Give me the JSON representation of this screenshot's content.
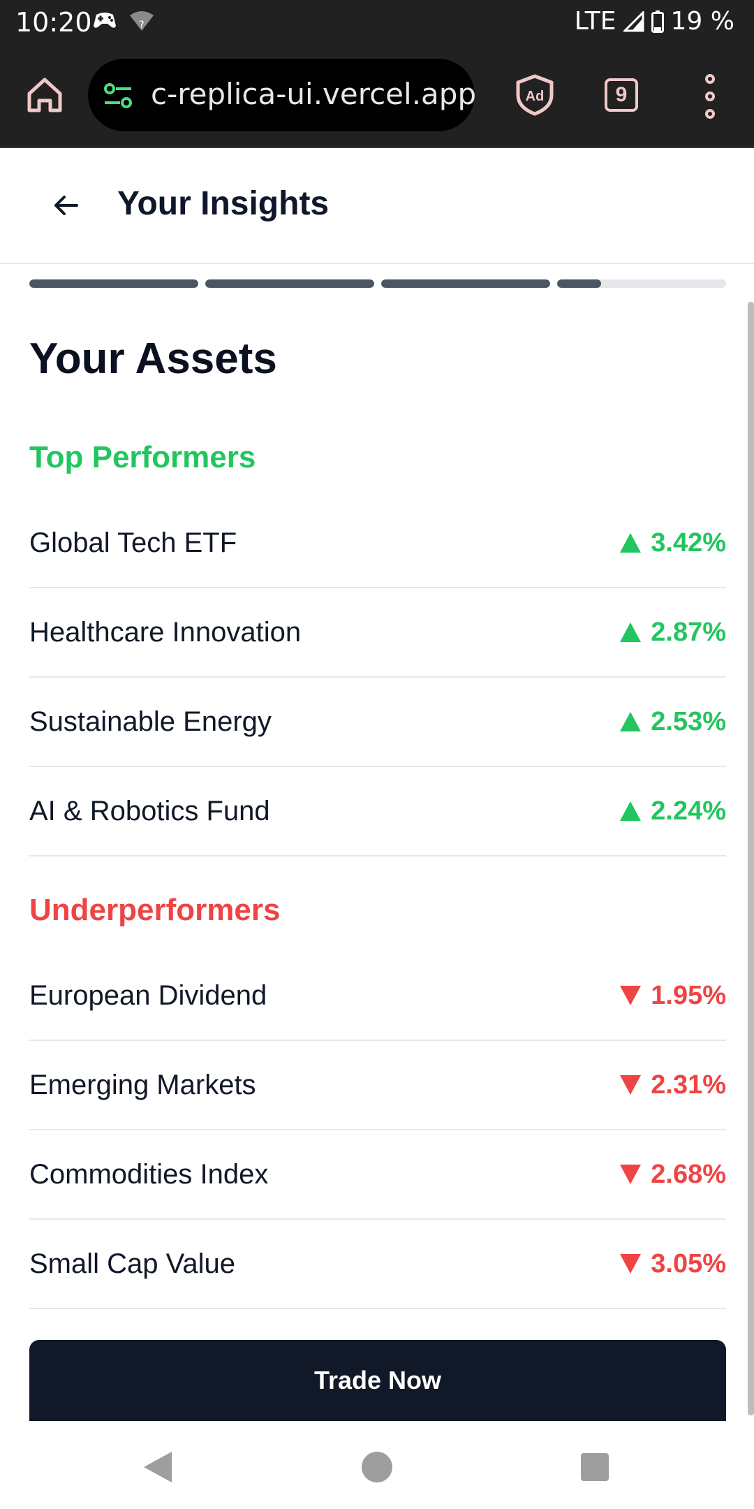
{
  "status_bar": {
    "time": "10:20",
    "network": "LTE",
    "battery": "19 %"
  },
  "browser": {
    "url": "c-replica-ui.vercel.app",
    "tab_count": "9",
    "ad_label": "Ad"
  },
  "header": {
    "title": "Your Insights"
  },
  "progress": {
    "segments": [
      1,
      1,
      1,
      0.26
    ]
  },
  "main": {
    "section_title": "Your Assets",
    "top_performers": {
      "title": "Top Performers",
      "items": [
        {
          "name": "Global Tech ETF",
          "change": "3.42%"
        },
        {
          "name": "Healthcare Innovation",
          "change": "2.87%"
        },
        {
          "name": "Sustainable Energy",
          "change": "2.53%"
        },
        {
          "name": "AI & Robotics Fund",
          "change": "2.24%"
        }
      ]
    },
    "underperformers": {
      "title": "Underperformers",
      "items": [
        {
          "name": "European Dividend",
          "change": "1.95%"
        },
        {
          "name": "Emerging Markets",
          "change": "2.31%"
        },
        {
          "name": "Commodities Index",
          "change": "2.68%"
        },
        {
          "name": "Small Cap Value",
          "change": "3.05%"
        }
      ]
    },
    "cta_label": "Trade Now"
  },
  "colors": {
    "positive": "#22c55e",
    "negative": "#ef4444",
    "primary_button": "#111827",
    "progress_fill": "#4b5563"
  }
}
